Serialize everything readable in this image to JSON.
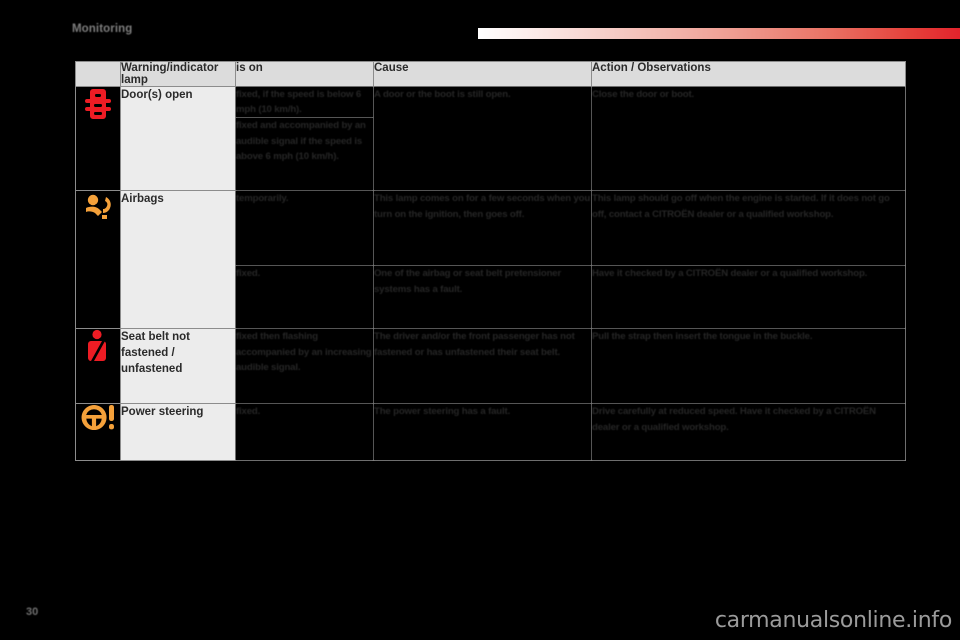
{
  "page": {
    "section_title": "Monitoring",
    "page_number": "30",
    "watermark": "carmanualsonline.info",
    "accent_color": "#e2232c",
    "header_gradient_from": "#ffffff",
    "header_gradient_to": "#e2232c"
  },
  "table": {
    "headers": [
      "",
      "Warning/indicator lamp",
      "is on",
      "Cause",
      "Action / Observations"
    ],
    "rows": [
      {
        "icon_name": "door-open-warning-icon",
        "icon_color": "#ed1c24",
        "lamp": "Door(s) open",
        "subrows": [
          {
            "is_on": "fixed, if the speed is below 6 mph (10 km/h).",
            "cause": "A door or the boot is still open.",
            "action": "Close the door or boot."
          },
          {
            "is_on": "fixed and accompanied by an audible signal if the speed is above 6 mph (10 km/h).",
            "cause": "",
            "action": ""
          }
        ]
      },
      {
        "icon_name": "airbag-warning-icon",
        "icon_color": "#f5a13a",
        "lamp": "Airbags",
        "subrows": [
          {
            "is_on": "temporarily.",
            "cause": "This lamp comes on for a few seconds when you turn on the ignition, then goes off.",
            "action": "This lamp should go off when the engine is started. If it does not go off, contact a CITROËN dealer or a qualified workshop."
          },
          {
            "is_on": "fixed.",
            "cause": "One of the airbag or seat belt pretensioner systems has a fault.",
            "action": "Have it checked by a CITROËN dealer or a qualified workshop."
          }
        ]
      },
      {
        "icon_name": "seat-belt-warning-icon",
        "icon_color": "#ed1c24",
        "lamp": "Seat belt not fastened / unfastened",
        "subrows": [
          {
            "is_on": "fixed then flashing accompanied by an increasing audible signal.",
            "cause": "The driver and/or the front passenger has not fastened or has unfastened their seat belt.",
            "action": "Pull the strap then insert the tongue in the buckle."
          }
        ]
      },
      {
        "icon_name": "power-steering-warning-icon",
        "icon_color": "#f5a13a",
        "lamp": "Power steering",
        "subrows": [
          {
            "is_on": "fixed.",
            "cause": "The power steering has a fault.",
            "action": "Drive carefully at reduced speed. Have it checked by a CITROËN dealer or a qualified workshop."
          }
        ]
      }
    ]
  }
}
